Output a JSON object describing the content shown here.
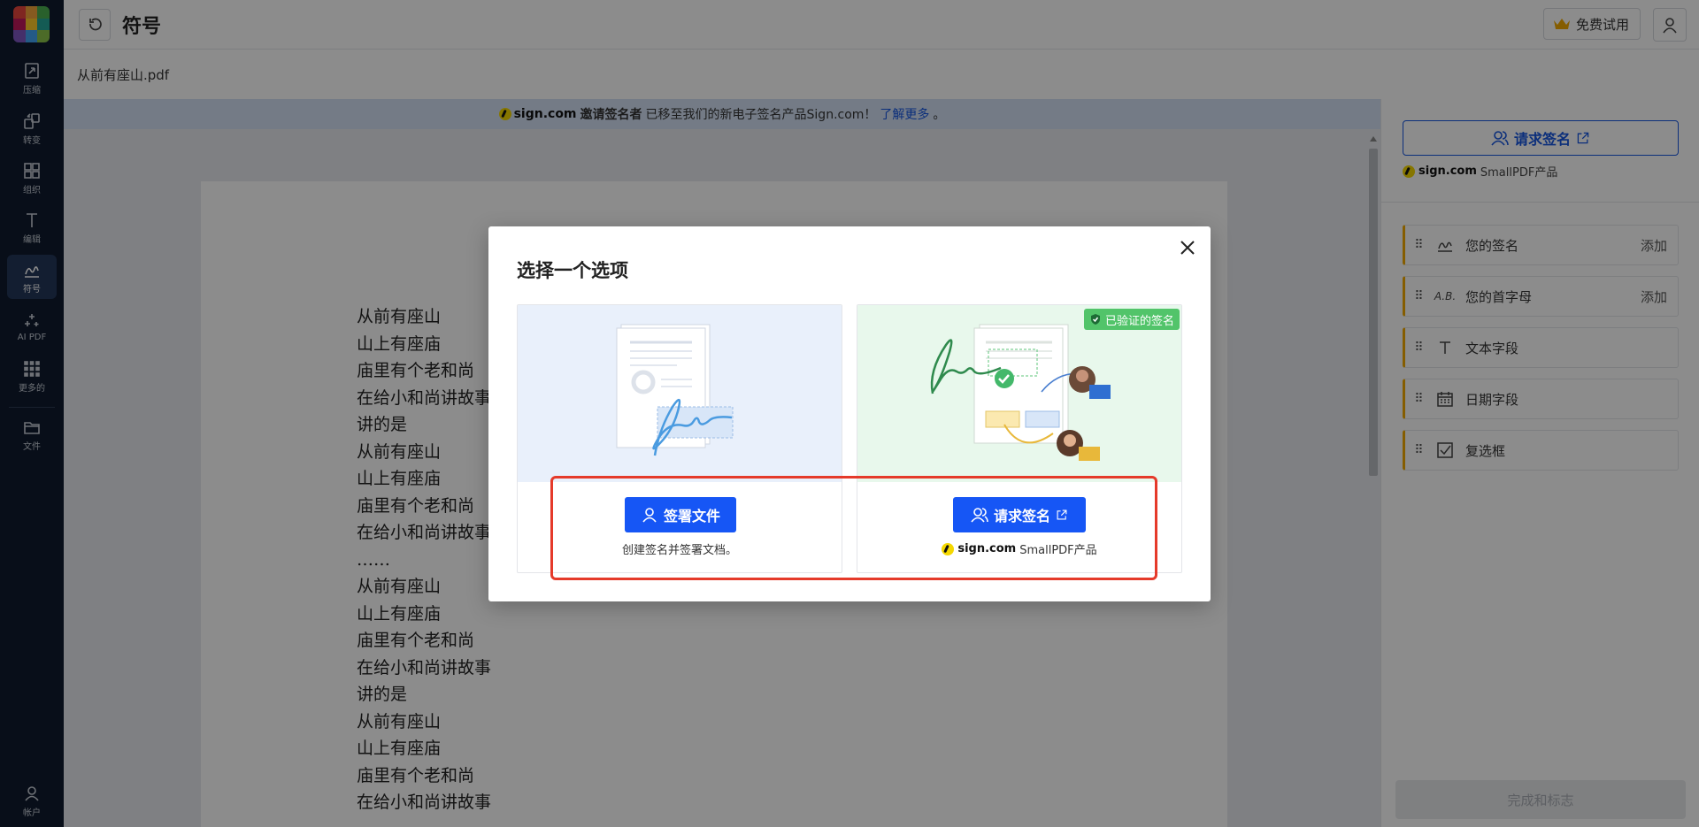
{
  "app": {
    "page_title": "符号",
    "filename": "从前有座山.pdf",
    "trial_label": "免费试用"
  },
  "nav": [
    {
      "label": "压缩",
      "icon": "compress-icon"
    },
    {
      "label": "转变",
      "icon": "convert-icon"
    },
    {
      "label": "组织",
      "icon": "organize-icon"
    },
    {
      "label": "编辑",
      "icon": "edit-text-icon"
    },
    {
      "label": "符号",
      "icon": "sign-icon"
    },
    {
      "label": "AI PDF",
      "icon": "sparkle-icon"
    },
    {
      "label": "更多的",
      "icon": "apps-grid-icon"
    },
    {
      "label": "文件",
      "icon": "folder-icon"
    },
    {
      "label": "帐户",
      "icon": "account-icon"
    }
  ],
  "notice": {
    "brand": "sign.com",
    "text_bold": "邀请签名者",
    "text": "已移至我们的新电子签名产品Sign.com！",
    "link": "了解更多",
    "end": "。"
  },
  "document": {
    "lines": [
      "从前有座山",
      "山上有座庙",
      "庙里有个老和尚",
      "在给小和尚讲故事",
      "讲的是",
      "从前有座山",
      "山上有座庙",
      "庙里有个老和尚",
      "在给小和尚讲故事",
      "……",
      "从前有座山",
      "山上有座庙",
      "庙里有个老和尚",
      "在给小和尚讲故事",
      "讲的是",
      "从前有座山",
      "山上有座庙",
      "庙里有个老和尚",
      "在给小和尚讲故事"
    ]
  },
  "panel": {
    "request_label": "请求签名",
    "brand": "sign.com",
    "brand_suffix": "SmallPDF产品",
    "fields": [
      {
        "label": "您的签名",
        "action": "添加",
        "icon": "signature-icon"
      },
      {
        "label": "您的首字母",
        "action": "添加",
        "icon": "initials-icon"
      },
      {
        "label": "文本字段",
        "action": "",
        "icon": "text-field-icon"
      },
      {
        "label": "日期字段",
        "action": "",
        "icon": "calendar-icon"
      },
      {
        "label": "复选框",
        "action": "",
        "icon": "checkbox-icon"
      }
    ],
    "finish_label": "完成和标志"
  },
  "modal": {
    "title": "选择一个选项",
    "left": {
      "button": "签署文件",
      "caption": "创建签名并签署文档。"
    },
    "right": {
      "badge": "已验证的签名",
      "button": "请求签名",
      "brand": "sign.com",
      "brand_suffix": "SmallPDF产品"
    }
  },
  "colors": {
    "accent": "#1656f5",
    "nav_bg": "#0f1b2e",
    "field_border": "#f2a900",
    "verified_badge": "#52c46a",
    "highlight": "#e53a2a"
  }
}
